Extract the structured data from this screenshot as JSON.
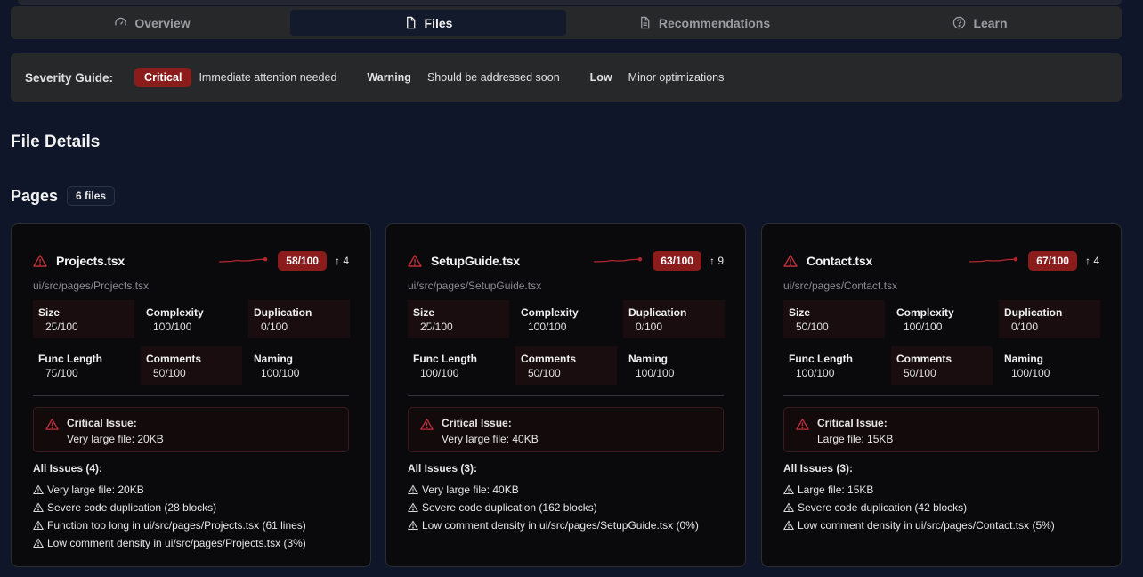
{
  "tabs": [
    {
      "label": "Overview",
      "icon": "gauge-icon",
      "active": false
    },
    {
      "label": "Files",
      "icon": "file-icon",
      "active": true
    },
    {
      "label": "Recommendations",
      "icon": "document-icon",
      "active": false
    },
    {
      "label": "Learn",
      "icon": "help-circle-icon",
      "active": false
    }
  ],
  "severity_guide": {
    "title": "Severity Guide:",
    "critical_label": "Critical",
    "critical_desc": "Immediate attention needed",
    "warning_label": "Warning",
    "warning_desc": "Should be addressed soon",
    "low_label": "Low",
    "low_desc": "Minor optimizations"
  },
  "file_details_title": "File Details",
  "section": {
    "title": "Pages",
    "count": "6 files"
  },
  "colors": {
    "critical": "#8a1c1c",
    "accent_line": "#b3262d"
  },
  "cards": [
    {
      "name": "Projects.tsx",
      "score": "58/100",
      "trend": "↑ 4",
      "path": "ui/src/pages/Projects.tsx",
      "metrics": [
        {
          "label": "Size",
          "value": "25/100",
          "highlight": true
        },
        {
          "label": "Complexity",
          "value": "100/100",
          "highlight": false
        },
        {
          "label": "Duplication",
          "value": "0/100",
          "highlight": true
        },
        {
          "label": "Func Length",
          "value": "75/100",
          "highlight": false
        },
        {
          "label": "Comments",
          "value": "50/100",
          "highlight": true
        },
        {
          "label": "Naming",
          "value": "100/100",
          "highlight": false
        }
      ],
      "critical_title": "Critical Issue:",
      "critical_text": "Very large file: 20KB",
      "issues_title": "All Issues (4):",
      "issues": [
        "Very large file: 20KB",
        "Severe code duplication (28 blocks)",
        "Function too long in ui/src/pages/Projects.tsx (61 lines)",
        "Low comment density in ui/src/pages/Projects.tsx (3%)"
      ]
    },
    {
      "name": "SetupGuide.tsx",
      "score": "63/100",
      "trend": "↑ 9",
      "path": "ui/src/pages/SetupGuide.tsx",
      "metrics": [
        {
          "label": "Size",
          "value": "25/100",
          "highlight": true
        },
        {
          "label": "Complexity",
          "value": "100/100",
          "highlight": false
        },
        {
          "label": "Duplication",
          "value": "0/100",
          "highlight": true
        },
        {
          "label": "Func Length",
          "value": "100/100",
          "highlight": false
        },
        {
          "label": "Comments",
          "value": "50/100",
          "highlight": true
        },
        {
          "label": "Naming",
          "value": "100/100",
          "highlight": false
        }
      ],
      "critical_title": "Critical Issue:",
      "critical_text": "Very large file: 40KB",
      "issues_title": "All Issues (3):",
      "issues": [
        "Very large file: 40KB",
        "Severe code duplication (162 blocks)",
        "Low comment density in ui/src/pages/SetupGuide.tsx (0%)"
      ]
    },
    {
      "name": "Contact.tsx",
      "score": "67/100",
      "trend": "↑ 4",
      "path": "ui/src/pages/Contact.tsx",
      "metrics": [
        {
          "label": "Size",
          "value": "50/100",
          "highlight": true
        },
        {
          "label": "Complexity",
          "value": "100/100",
          "highlight": false
        },
        {
          "label": "Duplication",
          "value": "0/100",
          "highlight": true
        },
        {
          "label": "Func Length",
          "value": "100/100",
          "highlight": false
        },
        {
          "label": "Comments",
          "value": "50/100",
          "highlight": true
        },
        {
          "label": "Naming",
          "value": "100/100",
          "highlight": false
        }
      ],
      "critical_title": "Critical Issue:",
      "critical_text": "Large file: 15KB",
      "issues_title": "All Issues (3):",
      "issues": [
        "Large file: 15KB",
        "Severe code duplication (42 blocks)",
        "Low comment density in ui/src/pages/Contact.tsx (5%)"
      ]
    }
  ]
}
